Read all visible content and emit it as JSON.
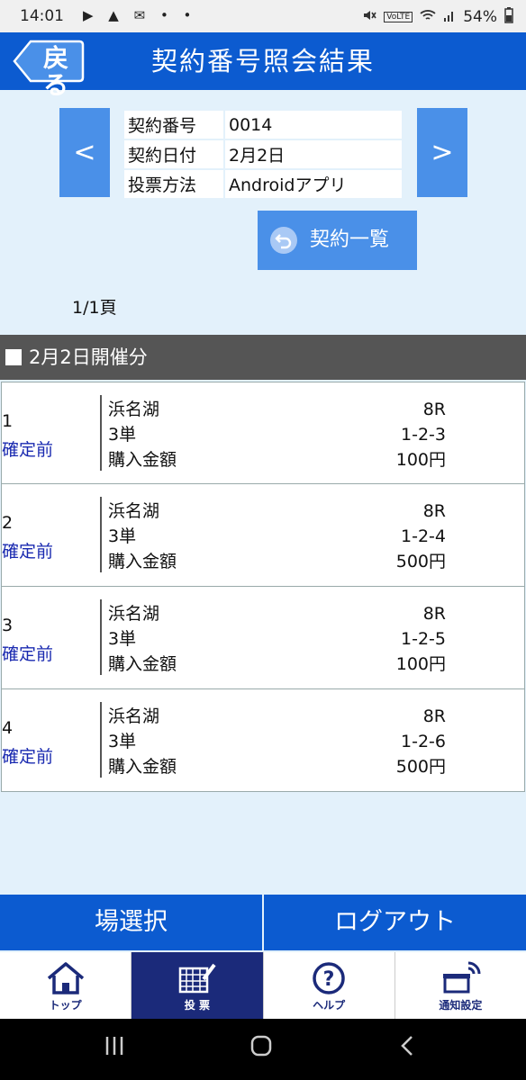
{
  "status": {
    "time": "14:01",
    "notif_icons": "▶ ▲ ✉ • •",
    "network": "VoLTE",
    "battery": "54%"
  },
  "header": {
    "back_label": "戻る",
    "title": "契約番号照会結果"
  },
  "contract": {
    "prev_label": "<",
    "next_label": ">",
    "rows": [
      {
        "key": "契約番号",
        "value": "0014"
      },
      {
        "key": "契約日付",
        "value": "2月2日"
      },
      {
        "key": "投票方法",
        "value": "Androidアプリ"
      }
    ],
    "list_button": "契約一覧",
    "page_indicator": "1/1頁"
  },
  "date_bar": {
    "label": "2月2日開催分"
  },
  "bets": [
    {
      "no": "1",
      "status": "確定前",
      "venue": "浜名湖",
      "race": "8R",
      "type": "3単",
      "combo": "1-2-3",
      "amount_label": "購入金額",
      "amount": "100円"
    },
    {
      "no": "2",
      "status": "確定前",
      "venue": "浜名湖",
      "race": "8R",
      "type": "3単",
      "combo": "1-2-4",
      "amount_label": "購入金額",
      "amount": "500円"
    },
    {
      "no": "3",
      "status": "確定前",
      "venue": "浜名湖",
      "race": "8R",
      "type": "3単",
      "combo": "1-2-5",
      "amount_label": "購入金額",
      "amount": "100円"
    },
    {
      "no": "4",
      "status": "確定前",
      "venue": "浜名湖",
      "race": "8R",
      "type": "3単",
      "combo": "1-2-6",
      "amount_label": "購入金額",
      "amount": "500円"
    }
  ],
  "bottom_buttons": {
    "venue_select": "場選択",
    "logout": "ログアウト"
  },
  "tabs": [
    {
      "label": "トップ",
      "icon": "home-icon"
    },
    {
      "label": "投 票",
      "icon": "betting-slip-icon",
      "active": true
    },
    {
      "label": "ヘルプ",
      "icon": "help-icon"
    },
    {
      "label": "通知設定",
      "icon": "notification-settings-icon"
    }
  ],
  "colors": {
    "header_blue": "#0c5bd0",
    "button_blue": "#4a90e8",
    "page_bg": "#e3f1fb",
    "date_bar": "#555555",
    "status_text": "#1a2ab0",
    "active_tab": "#1b2a7a"
  }
}
